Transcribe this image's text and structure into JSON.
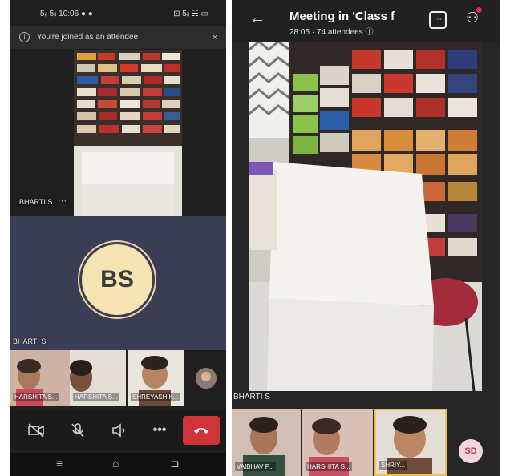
{
  "left_phone": {
    "status_time": "5ᵢₗ 5ᵢₗ 10:06 ● ● ···",
    "status_icons": "⊡ 5ᵢₗ ☵ ▭",
    "notice": {
      "icon": "info-icon",
      "text": "You're joined as an attendee",
      "close": "×"
    },
    "video_name": "BHARTI S",
    "video_more": "···",
    "panel_name": "BHARTI S",
    "avatar_initials": "BS",
    "thumbnails": [
      {
        "label": "HARSHITA S..."
      },
      {
        "label": "HARSHITA S..."
      },
      {
        "label": "SHREYASH K..."
      }
    ],
    "controls": [
      "camera-off-icon",
      "mic-off-icon",
      "speaker-icon",
      "more-icon",
      "hangup-icon"
    ],
    "nav": [
      "recent-apps-icon",
      "home-icon",
      "back-icon"
    ]
  },
  "right_phone": {
    "title": "Meeting in 'Class f",
    "subtitle": "28:05 · 74 attendees ⓘ",
    "main_video_name": "BHARTI S",
    "thumbnails": [
      {
        "label": "VAIBHAV P..."
      },
      {
        "label": "HARSHITA S..."
      },
      {
        "label": "SHRIY..."
      }
    ],
    "avatar_initials": "SD"
  }
}
